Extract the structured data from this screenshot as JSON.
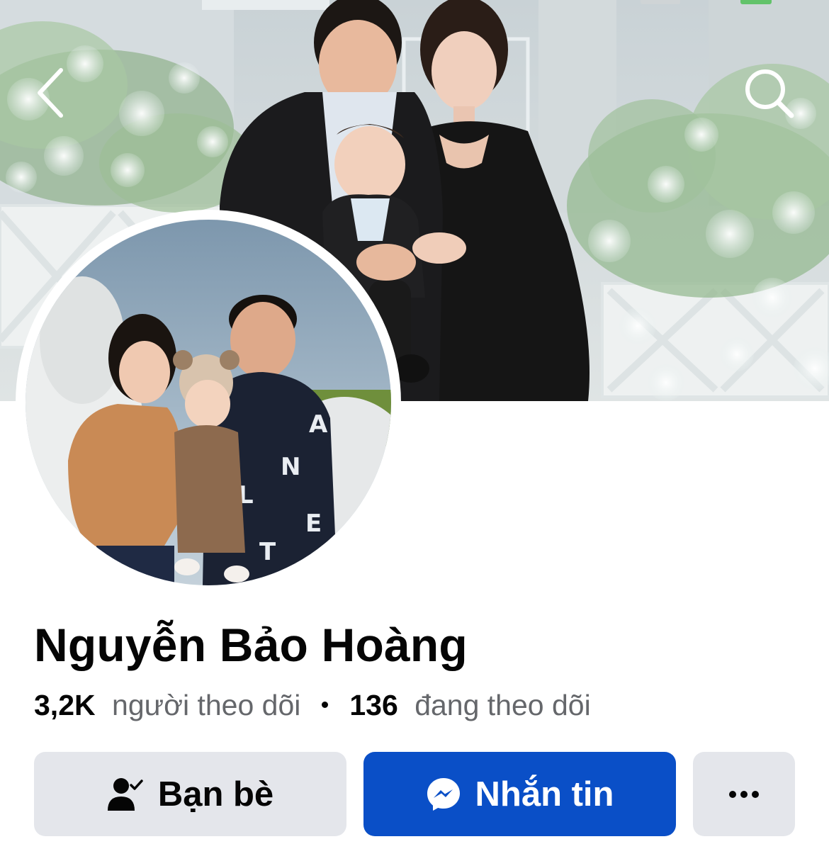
{
  "profile": {
    "name": "Nguyễn Bảo Hoàng",
    "followers_count": "3,2K",
    "followers_label": "người theo dõi",
    "following_count": "136",
    "following_label": "đang theo dõi"
  },
  "actions": {
    "friends_label": "Bạn bè",
    "message_label": "Nhắn tin"
  },
  "icons": {
    "back": "chevron-left-icon",
    "search": "search-icon",
    "friends": "friend-check-icon",
    "messenger": "messenger-icon",
    "more": "more-dots-icon"
  },
  "colors": {
    "primary_button": "#0a4fc7",
    "secondary_button": "#e4e6eb",
    "text_primary": "#050505",
    "text_secondary": "#65676b"
  }
}
